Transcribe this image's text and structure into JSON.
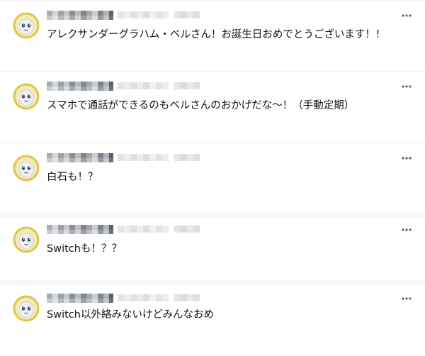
{
  "colors": {
    "text": "#0f1419",
    "avatar_ring": "#e1c54a",
    "avatar_face": "#eef0f4",
    "divider": "#eff3f4",
    "blur_dark": "#8a8f95",
    "blur_light": "#d5d9de"
  },
  "icons": {
    "avatar": "ghost-mascot-avatar",
    "more": "more-horizontal-icon"
  },
  "posts": [
    {
      "text": "アレクサンダーグラハム・ベルさん！お誕生日おめでとうございます！！"
    },
    {
      "text": "スマホで通話ができるのもベルさんのおかげだな～！（手動定期）"
    },
    {
      "text": "白石も！？"
    },
    {
      "text": "Switchも！？？"
    },
    {
      "text": "Switch以外絡みないけどみんなおめ"
    }
  ]
}
